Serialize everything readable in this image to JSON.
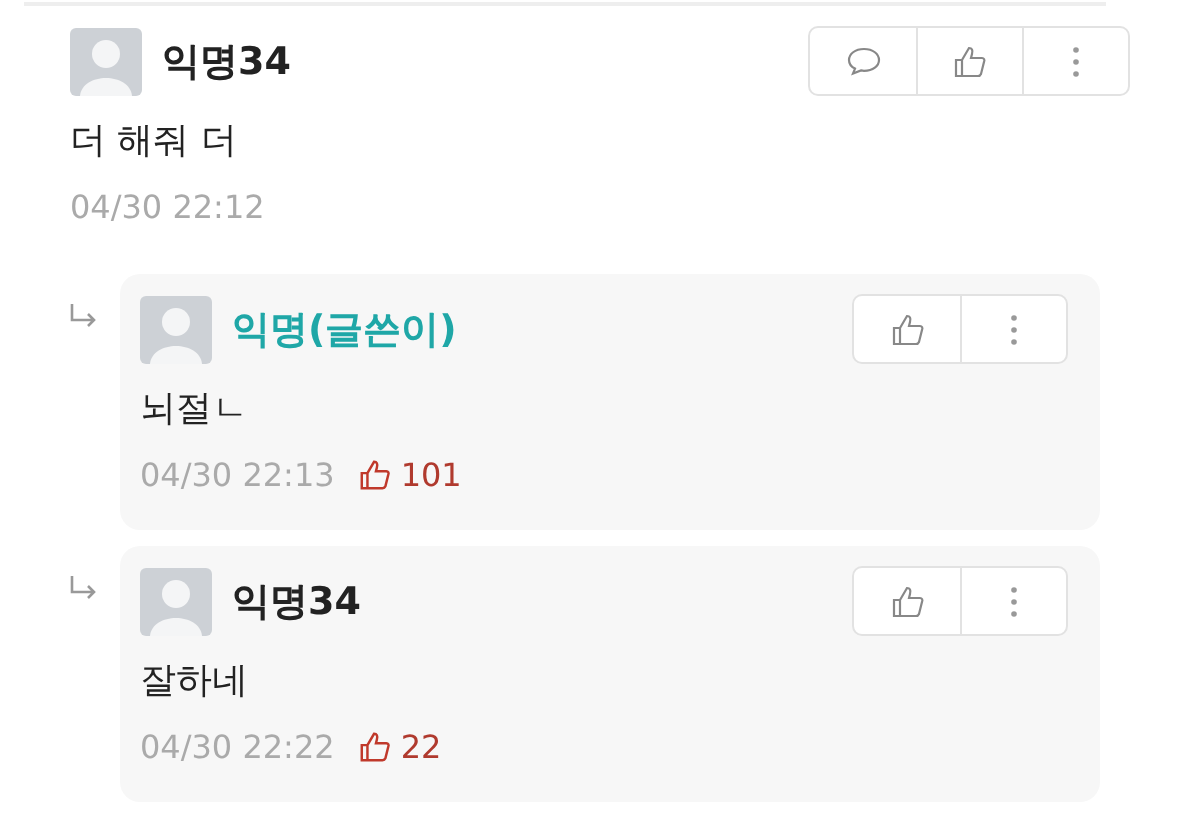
{
  "comments": [
    {
      "kind": "comment",
      "author": "익명34",
      "op": false,
      "text": "더 해줘 더",
      "time": "04/30 22:12"
    },
    {
      "kind": "reply",
      "author": "익명(글쓴이)",
      "op": true,
      "text": "뇌절ㄴ",
      "time": "04/30 22:13",
      "likes": "101"
    },
    {
      "kind": "reply",
      "author": "익명34",
      "op": false,
      "text": "잘하네",
      "time": "04/30 22:22",
      "likes": "22"
    }
  ]
}
